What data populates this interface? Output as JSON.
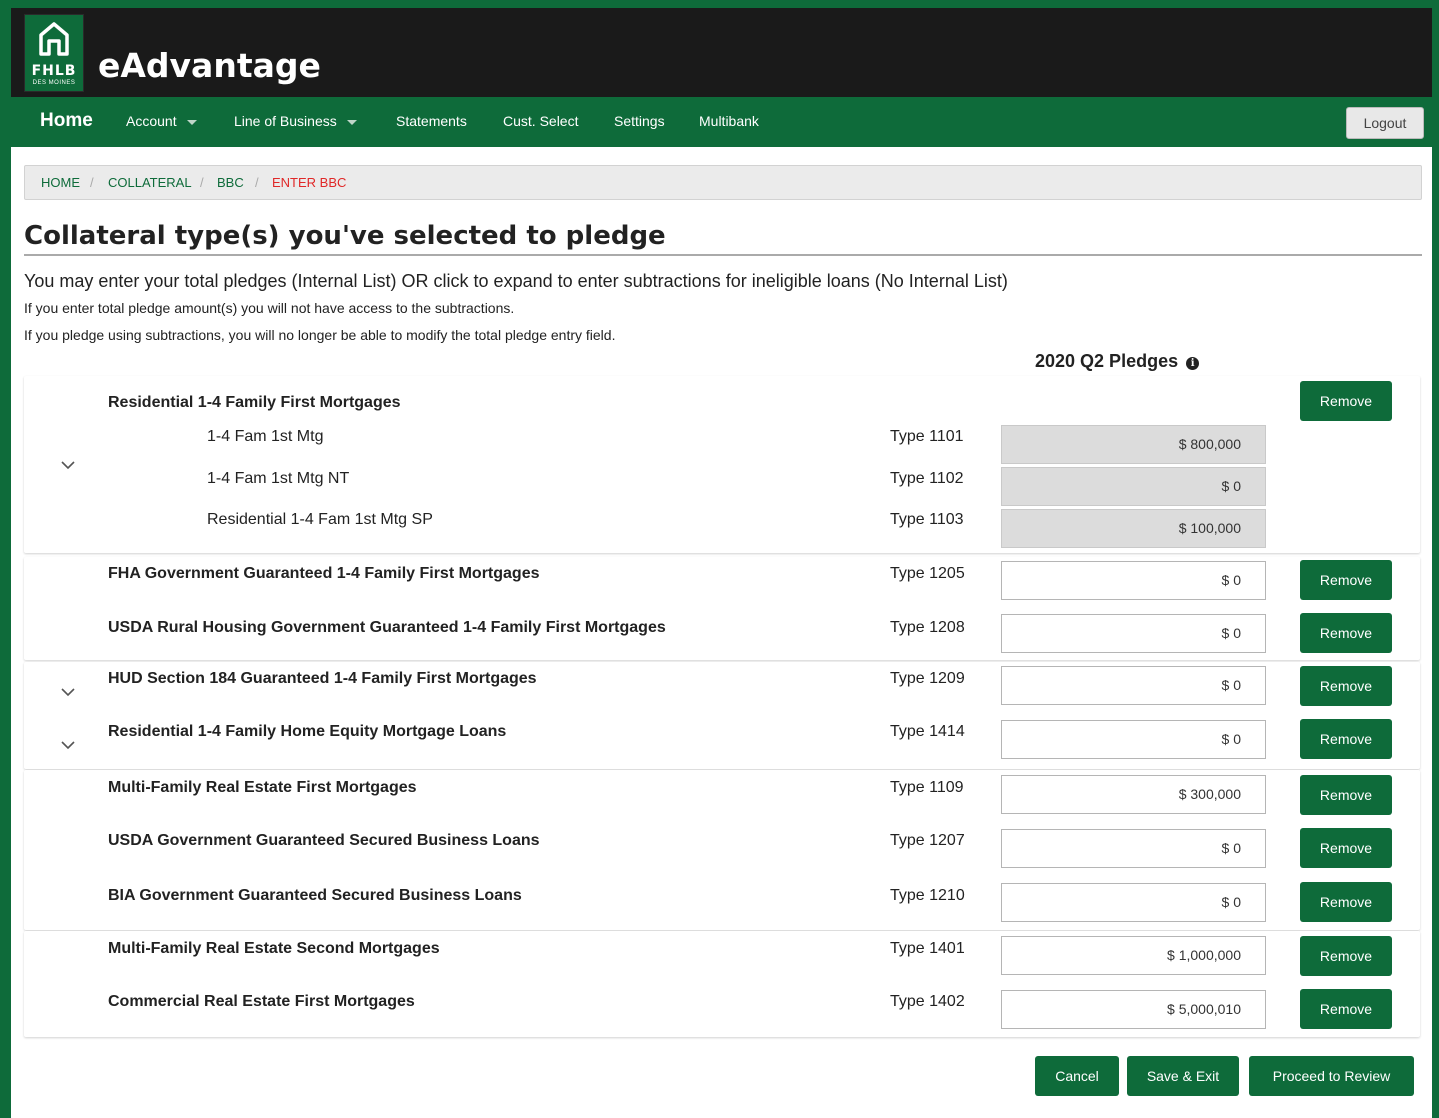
{
  "app": {
    "logo_text": "FHLB",
    "logo_subtext": "DES MOINES",
    "title": "eAdvantage"
  },
  "nav": {
    "home": "Home",
    "account": "Account",
    "line_of_business": "Line of Business",
    "statements": "Statements",
    "cust_select": "Cust. Select",
    "settings": "Settings",
    "multibank": "Multibank",
    "logout": "Logout"
  },
  "breadcrumb": [
    "HOME",
    "COLLATERAL",
    "BBC",
    "ENTER BBC"
  ],
  "page": {
    "title": "Collateral type(s) you've selected to pledge",
    "intro": "You may enter your total pledges (Internal List) OR click to expand to enter subtractions for ineligible loans (No Internal List)",
    "note1": "If you enter total pledge amount(s) you will not have access to the subtractions.",
    "note2": "If you pledge using subtractions, you will no longer be able to modify the total pledge entry field.",
    "column_header": "2020 Q2 Pledges",
    "info_icon": "i"
  },
  "residential_group": {
    "title": "Residential 1-4 Family First Mortgages",
    "remove": "Remove",
    "subitems": [
      {
        "name": "1-4 Fam 1st Mtg",
        "type": "Type 1101",
        "amount": "$ 800,000"
      },
      {
        "name": "1-4 Fam 1st Mtg NT",
        "type": "Type 1102",
        "amount": "$ 0"
      },
      {
        "name": "Residential 1-4 Fam 1st Mtg SP",
        "type": "Type 1103",
        "amount": "$ 100,000"
      }
    ]
  },
  "rows": [
    {
      "title": "FHA Government Guaranteed 1-4 Family First Mortgages",
      "type": "Type 1205",
      "amount": "$ 0",
      "remove": "Remove"
    },
    {
      "title": "USDA Rural Housing Government Guaranteed 1-4 Family First Mortgages",
      "type": "Type 1208",
      "amount": "$ 0",
      "remove": "Remove"
    },
    {
      "title": "HUD Section 184 Guaranteed 1-4 Family First Mortgages",
      "type": "Type 1209",
      "amount": "$ 0",
      "remove": "Remove"
    },
    {
      "title": "Residential 1-4 Family Home Equity Mortgage Loans",
      "type": "Type 1414",
      "amount": "$ 0",
      "remove": "Remove"
    },
    {
      "title": "Multi-Family Real Estate First Mortgages",
      "type": "Type 1109",
      "amount": "$ 300,000",
      "remove": "Remove"
    },
    {
      "title": "USDA Government Guaranteed Secured Business Loans",
      "type": "Type 1207",
      "amount": "$ 0",
      "remove": "Remove"
    },
    {
      "title": "BIA Government Guaranteed Secured Business Loans",
      "type": "Type 1210",
      "amount": "$ 0",
      "remove": "Remove"
    },
    {
      "title": "Multi-Family Real Estate Second Mortgages",
      "type": "Type 1401",
      "amount": "$ 1,000,000",
      "remove": "Remove"
    },
    {
      "title": "Commercial Real Estate First Mortgages",
      "type": "Type 1402",
      "amount": "$ 5,000,010",
      "remove": "Remove"
    }
  ],
  "footer": {
    "cancel": "Cancel",
    "save_exit": "Save & Exit",
    "proceed": "Proceed to Review"
  },
  "colors": {
    "brand_green": "#0e6b3a",
    "header_black": "#1a1a1a",
    "breadcrumb_active": "#e02828"
  }
}
